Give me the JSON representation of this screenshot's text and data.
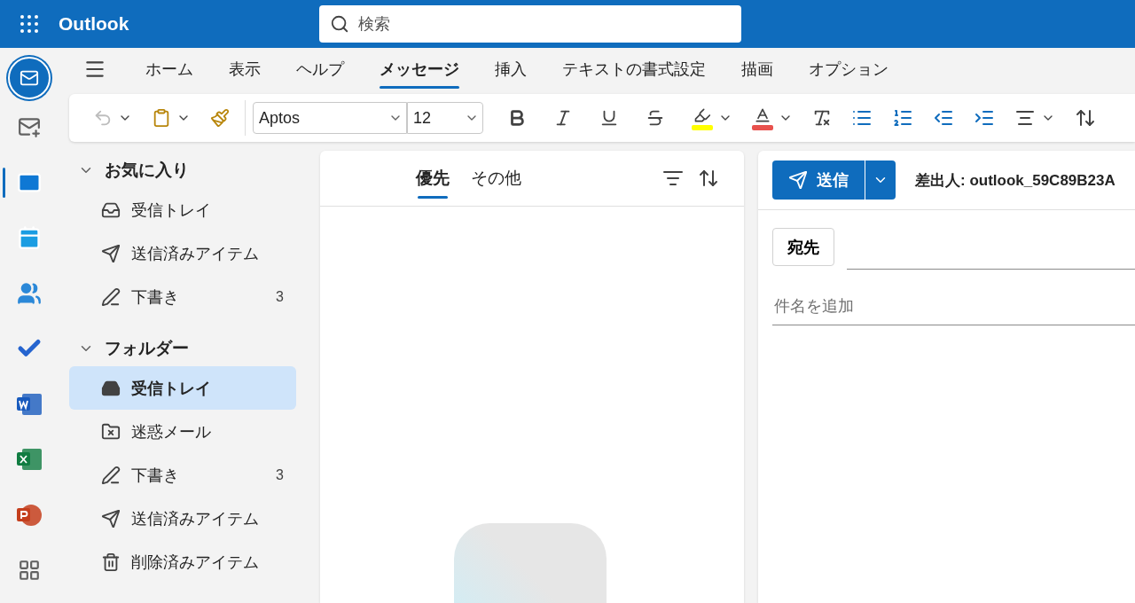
{
  "app": {
    "name": "Outlook"
  },
  "search": {
    "placeholder": "検索"
  },
  "rail": [
    {
      "kind": "new-mail",
      "selected": false
    },
    {
      "kind": "mail",
      "selected": true
    },
    {
      "kind": "calendar",
      "selected": false
    },
    {
      "kind": "people",
      "selected": false
    },
    {
      "kind": "todo",
      "selected": false
    },
    {
      "kind": "word",
      "selected": false
    },
    {
      "kind": "excel",
      "selected": false
    },
    {
      "kind": "powerpoint",
      "selected": false
    },
    {
      "kind": "apps",
      "selected": false
    }
  ],
  "ribbon_tabs": [
    {
      "label": "ホーム",
      "selected": false
    },
    {
      "label": "表示",
      "selected": false
    },
    {
      "label": "ヘルプ",
      "selected": false
    },
    {
      "label": "メッセージ",
      "selected": true
    },
    {
      "label": "挿入",
      "selected": false
    },
    {
      "label": "テキストの書式設定",
      "selected": false
    },
    {
      "label": "描画",
      "selected": false
    },
    {
      "label": "オプション",
      "selected": false
    }
  ],
  "toolbar": {
    "font": "Aptos",
    "size": "12"
  },
  "folder_sections": [
    {
      "title": "お気に入り",
      "expanded": true,
      "items": [
        {
          "kind": "inbox",
          "label": "受信トレイ",
          "selected": false
        },
        {
          "kind": "sent",
          "label": "送信済みアイテム",
          "selected": false
        },
        {
          "kind": "drafts",
          "label": "下書き",
          "count": "3",
          "selected": false
        }
      ]
    },
    {
      "title": "フォルダー",
      "expanded": true,
      "items": [
        {
          "kind": "inbox",
          "label": "受信トレイ",
          "selected": true
        },
        {
          "kind": "junk",
          "label": "迷惑メール",
          "selected": false
        },
        {
          "kind": "drafts",
          "label": "下書き",
          "count": "3",
          "selected": false
        },
        {
          "kind": "sent",
          "label": "送信済みアイテム",
          "selected": false
        },
        {
          "kind": "deleted",
          "label": "削除済みアイテム",
          "selected": false
        }
      ]
    }
  ],
  "message_list": {
    "tabs": [
      {
        "label": "優先",
        "selected": true
      },
      {
        "label": "その他",
        "selected": false
      }
    ]
  },
  "compose": {
    "send_label": "送信",
    "from": "差出人: outlook_59C89B23A",
    "to_label": "宛先",
    "subject_placeholder": "件名を追加"
  }
}
